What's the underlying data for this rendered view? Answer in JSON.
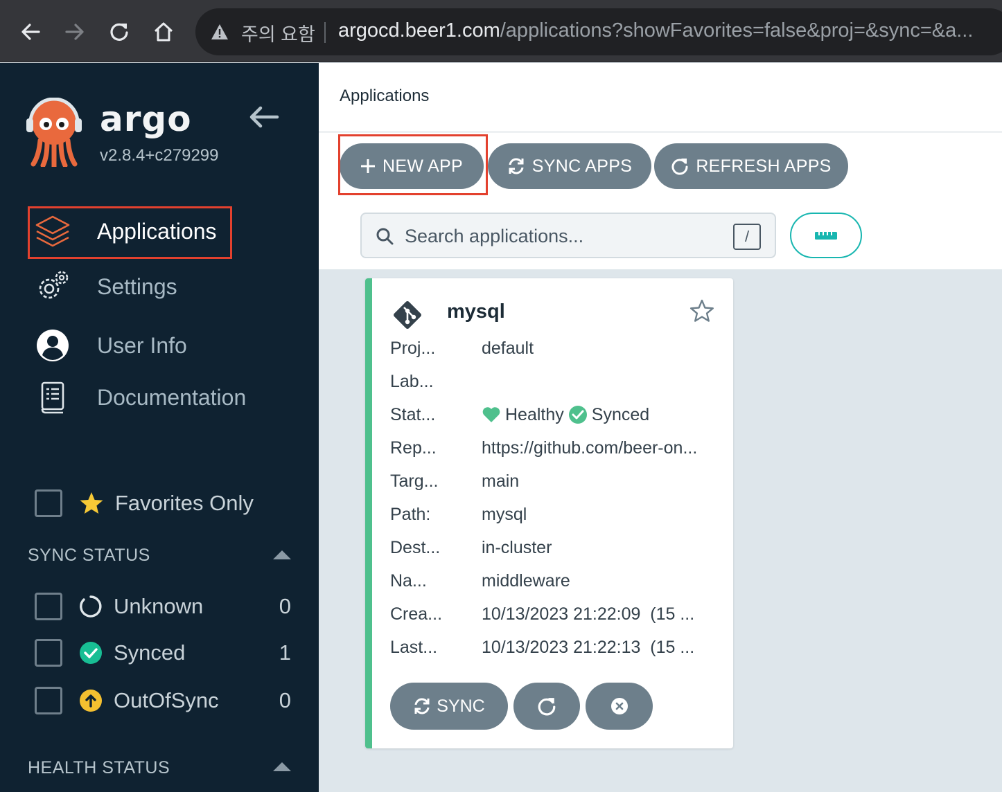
{
  "browser": {
    "warning": "주의 요함",
    "url_host": "argocd.beer1.com",
    "url_path": "/applications?showFavorites=false&proj=&sync=&a..."
  },
  "sidebar": {
    "logo_text": "argo",
    "version": "v2.8.4+c279299",
    "nav": [
      {
        "label": "Applications",
        "icon": "layers-icon",
        "active": true
      },
      {
        "label": "Settings",
        "icon": "gears-icon"
      },
      {
        "label": "User Info",
        "icon": "user-circle-icon"
      },
      {
        "label": "Documentation",
        "icon": "book-icon"
      }
    ],
    "favorites_label": "Favorites Only",
    "sync_status_title": "SYNC STATUS",
    "sync_filters": [
      {
        "label": "Unknown",
        "count": "0",
        "icon": "circle-notch-icon"
      },
      {
        "label": "Synced",
        "count": "1",
        "icon": "check-circle-icon",
        "color": "#18be94"
      },
      {
        "label": "OutOfSync",
        "count": "0",
        "icon": "arrow-up-circle-icon",
        "color": "#f4c030"
      }
    ],
    "health_status_title": "HEALTH STATUS"
  },
  "main": {
    "title": "Applications",
    "toolbar": {
      "new_app": "NEW APP",
      "sync_apps": "SYNC APPS",
      "refresh_apps": "REFRESH APPS"
    },
    "search": {
      "placeholder": "Search applications...",
      "shortcut": "/"
    }
  },
  "app_card": {
    "name": "mysql",
    "fields": [
      {
        "key": "Proj...",
        "value": "default"
      },
      {
        "key": "Lab...",
        "value": ""
      },
      {
        "key": "Stat...",
        "health": "Healthy",
        "sync": "Synced"
      },
      {
        "key": "Rep...",
        "value": "https://github.com/beer-on..."
      },
      {
        "key": "Targ...",
        "value": "main"
      },
      {
        "key": "Path:",
        "value": "mysql"
      },
      {
        "key": "Dest...",
        "value": "in-cluster"
      },
      {
        "key": "Na...",
        "value": "middleware"
      },
      {
        "key": "Crea...",
        "value": "10/13/2023 21:22:09  (15 ..."
      },
      {
        "key": "Last...",
        "value": "10/13/2023 21:22:13  (15 ..."
      }
    ],
    "actions": {
      "sync": "SYNC"
    },
    "colors": {
      "healthy": "#4fc08d",
      "synced": "#18be94",
      "accent": "#18b6b0",
      "highlight": "#e3412e"
    }
  }
}
